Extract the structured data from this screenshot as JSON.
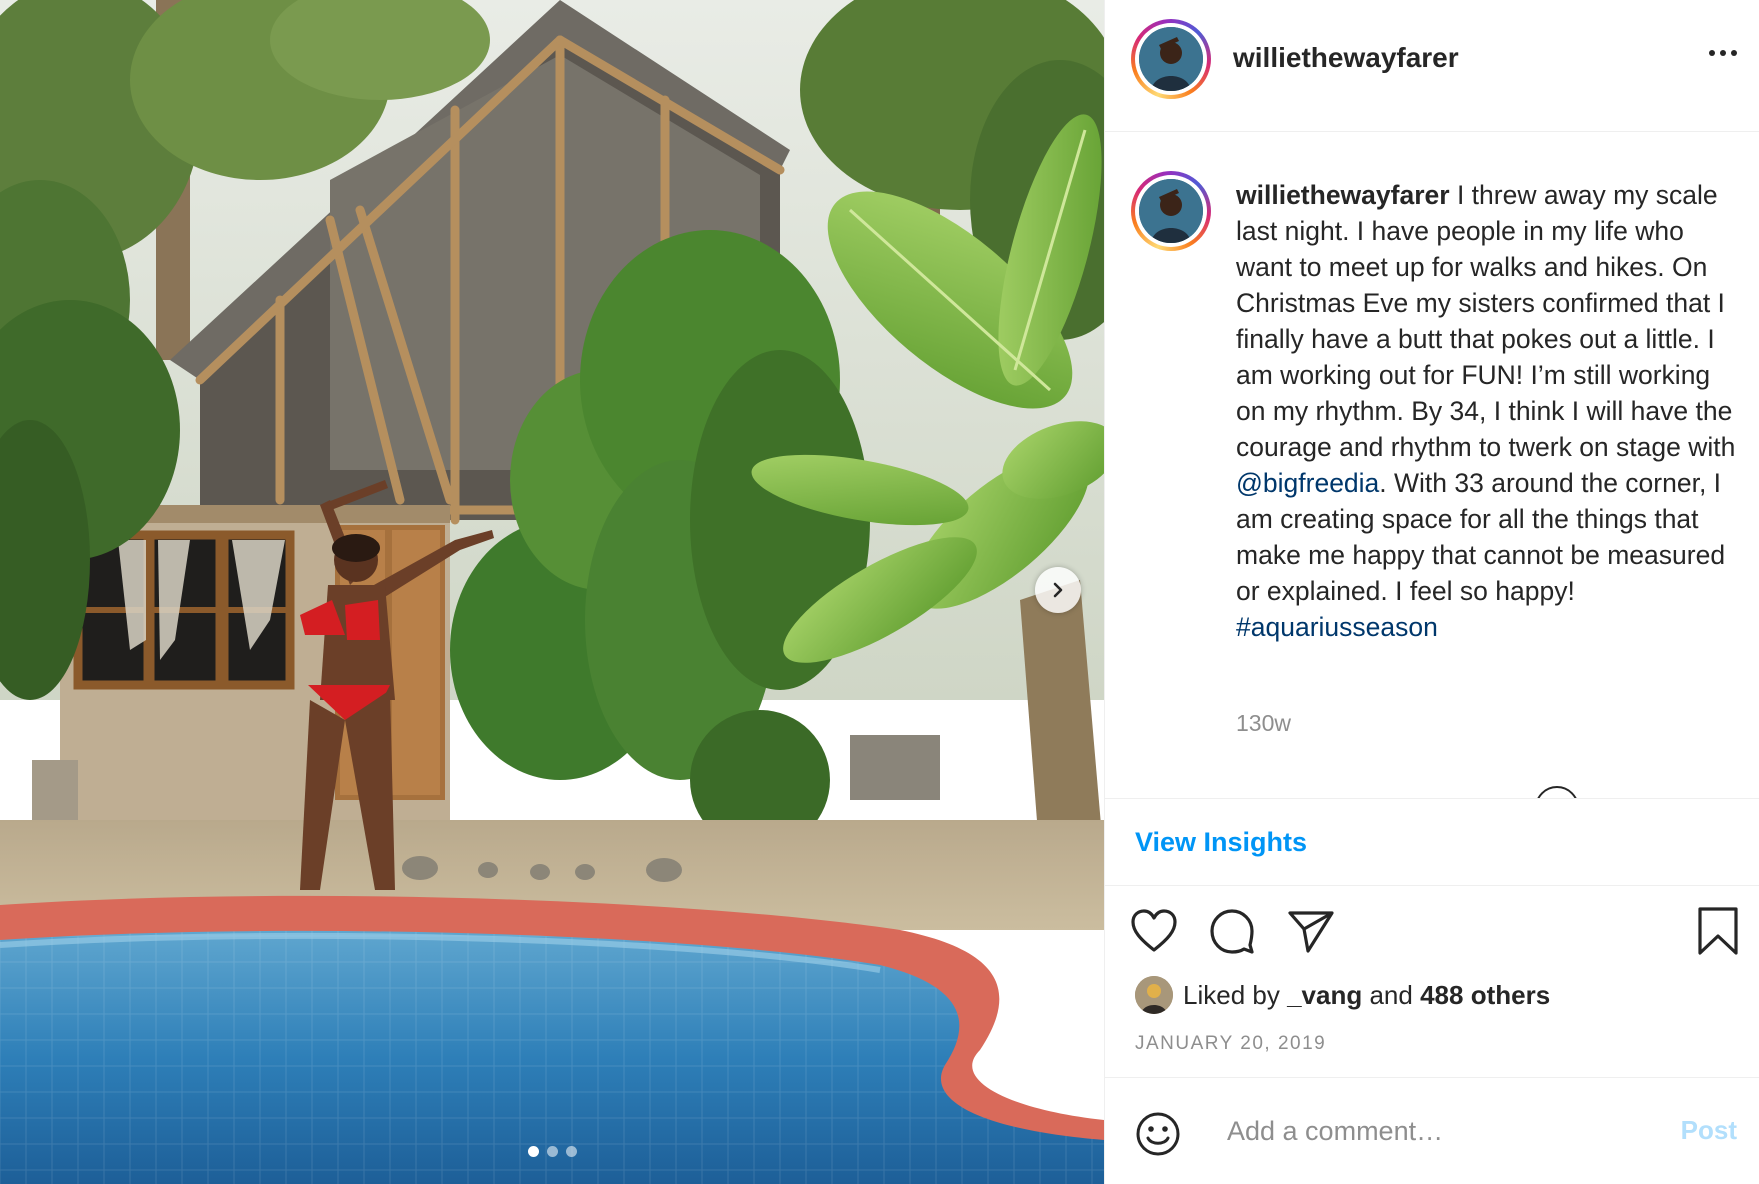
{
  "post": {
    "username": "williethewayfarer",
    "caption_text": "I threw away my scale last night. I have people in my life who want to meet up for walks and hikes. On Christmas Eve my sisters confirmed that I finally have a butt that pokes out a little. I am working out for FUN! I’m still working on my rhythm. By 34, I think I will have the courage and rhythm to twerk on stage with ",
    "mention": "@bigfreedia",
    "caption_text_2": ". With 33 around the corner, I am creating space for all the things that make me happy that cannot be measured or explained. I feel so happy! ",
    "hashtag": "#aquariusseason",
    "age": "130w",
    "insights_label": "View Insights",
    "liked_by_prefix": "Liked by",
    "liked_by_user": "_vang",
    "liked_by_and": "and",
    "liked_by_others": "488 others",
    "date": "JANUARY 20, 2019",
    "carousel": {
      "count": 3,
      "active_index": 0
    }
  },
  "comment": {
    "placeholder": "Add a comment…",
    "post_label": "Post"
  },
  "icons": {
    "more": "more-options-icon",
    "like": "heart-icon",
    "comment": "comment-bubble-icon",
    "share": "paper-plane-icon",
    "save": "bookmark-icon",
    "emoji": "smiley-icon",
    "next": "chevron-right-icon"
  },
  "colors": {
    "link_blue": "#0095f6",
    "tag_blue": "#00376b",
    "muted": "#8e8e8e",
    "post_disabled": "#b2dffc"
  }
}
